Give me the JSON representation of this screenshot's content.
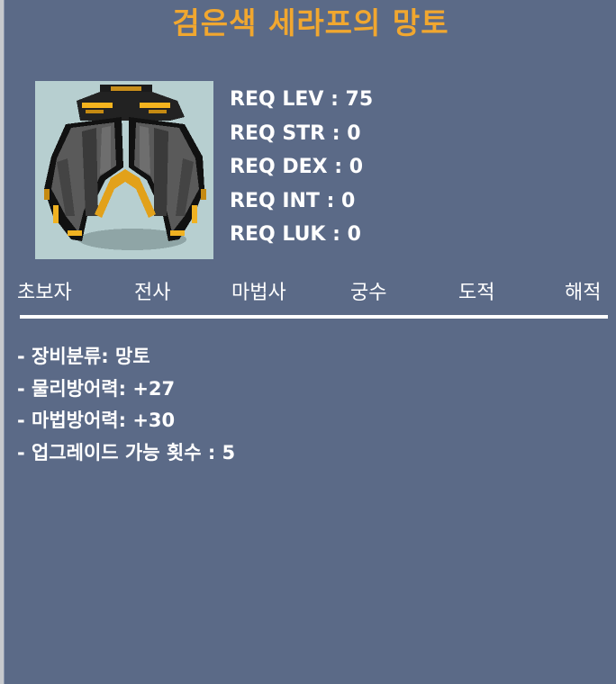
{
  "item": {
    "name": "검은색 세라프의 망토",
    "image_icon": "dark-cape-icon"
  },
  "requirements": [
    {
      "text": "REQ LEV : 75"
    },
    {
      "text": "REQ STR : 0"
    },
    {
      "text": "REQ DEX : 0"
    },
    {
      "text": "REQ INT : 0"
    },
    {
      "text": "REQ LUK : 0"
    }
  ],
  "jobs": [
    {
      "label": "초보자"
    },
    {
      "label": "전사"
    },
    {
      "label": "마법사"
    },
    {
      "label": "궁수"
    },
    {
      "label": "도적"
    },
    {
      "label": "해적"
    }
  ],
  "stats": [
    {
      "text": "- 장비분류: 망토"
    },
    {
      "text": "- 물리방어력: +27"
    },
    {
      "text": "- 마법방어력: +30"
    },
    {
      "text": "- 업그레이드 가능 횟수 : 5"
    }
  ],
  "colors": {
    "panel_bg": "#5b6a87",
    "title": "#f1a72f",
    "text": "#ffffff"
  }
}
